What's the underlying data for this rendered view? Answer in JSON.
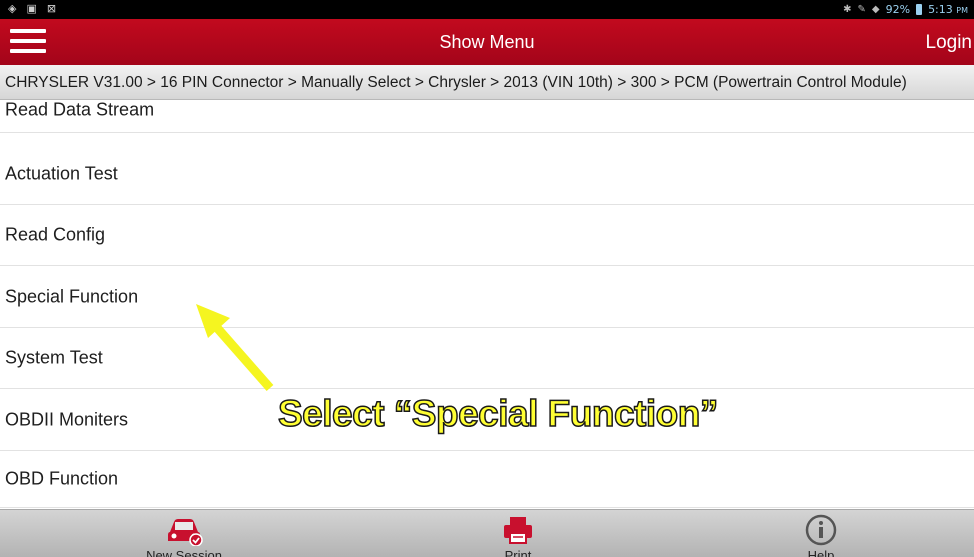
{
  "header": {
    "title": "Show Menu",
    "login_label": "Login"
  },
  "status_bar": {
    "battery": "92%",
    "time": "5:13",
    "ampm": "PM"
  },
  "breadcrumb": "CHRYSLER V31.00 > 16 PIN Connector > Manually Select > Chrysler > 2013 (VIN 10th) > 300 > PCM (Powertrain Control Module)",
  "menu_items": [
    "Read Data Stream",
    "Actuation Test",
    "Read Config",
    "Special Function",
    "System Test",
    "OBDII Moniters",
    "OBD Function"
  ],
  "annotation": {
    "caption": "Select “Special Function”",
    "color": "#ffff33"
  },
  "bottom_nav": [
    {
      "label": "New Session",
      "icon": "car-check-icon"
    },
    {
      "label": "Print",
      "icon": "printer-icon"
    },
    {
      "label": "Help",
      "icon": "info-icon"
    }
  ],
  "colors": {
    "header": "#b10619",
    "accent": "#c8102e"
  }
}
